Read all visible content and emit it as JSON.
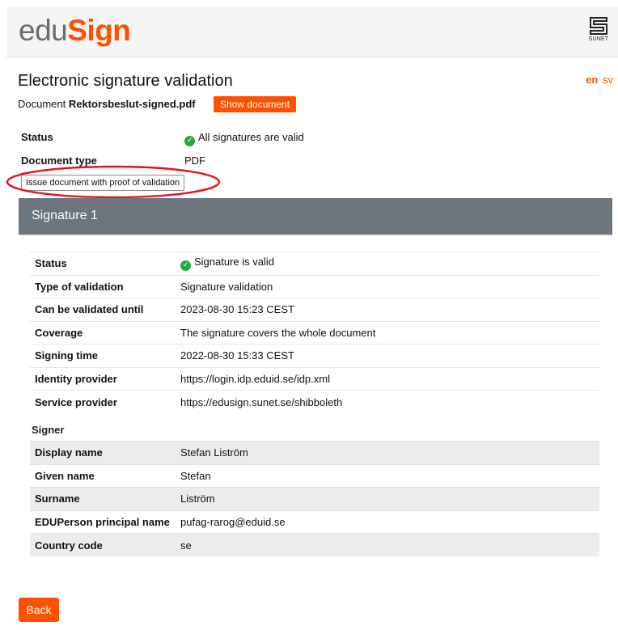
{
  "header": {
    "logo_edu": "edu",
    "logo_sign": "Sign",
    "sunet_label": "SUNET"
  },
  "lang": {
    "en": "en",
    "sv": "sv"
  },
  "page_title": "Electronic signature validation",
  "document": {
    "label": "Document",
    "filename": "Rektorsbeslut-signed.pdf",
    "show_button": "Show document"
  },
  "summary": [
    {
      "key": "Status",
      "value": "All signatures are valid",
      "ok": true
    },
    {
      "key": "Document type",
      "value": "PDF"
    }
  ],
  "issue_button": "Issue document with proof of validation",
  "annotation": {
    "color": "#e8141c"
  },
  "signature": {
    "title": "Signature 1",
    "rows": [
      {
        "key": "Status",
        "value": "Signature is valid",
        "ok": true
      },
      {
        "key": "Type of validation",
        "value": "Signature validation"
      },
      {
        "key": "Can be validated until",
        "value": "2023-08-30 15:23 CEST"
      },
      {
        "key": "Coverage",
        "value": "The signature covers the whole document"
      },
      {
        "key": "Signing time",
        "value": "2022-08-30 15:33 CEST"
      },
      {
        "key": "Identity provider",
        "value": "https://login.idp.eduid.se/idp.xml"
      },
      {
        "key": "Service provider",
        "value": "https://edusign.sunet.se/shibboleth"
      }
    ],
    "signer_label": "Signer",
    "signer_rows": [
      {
        "key": "Display name",
        "value": "Stefan Liström"
      },
      {
        "key": "Given name",
        "value": "Stefan"
      },
      {
        "key": "Surname",
        "value": "Liström"
      },
      {
        "key": "EDUPerson principal name",
        "value": "pufag-rarog@eduid.se"
      },
      {
        "key": "Country code",
        "value": "se"
      }
    ]
  },
  "back_button": "Back",
  "colors": {
    "accent": "#ff5000",
    "panel": "#6c747c",
    "valid": "#28a745"
  }
}
